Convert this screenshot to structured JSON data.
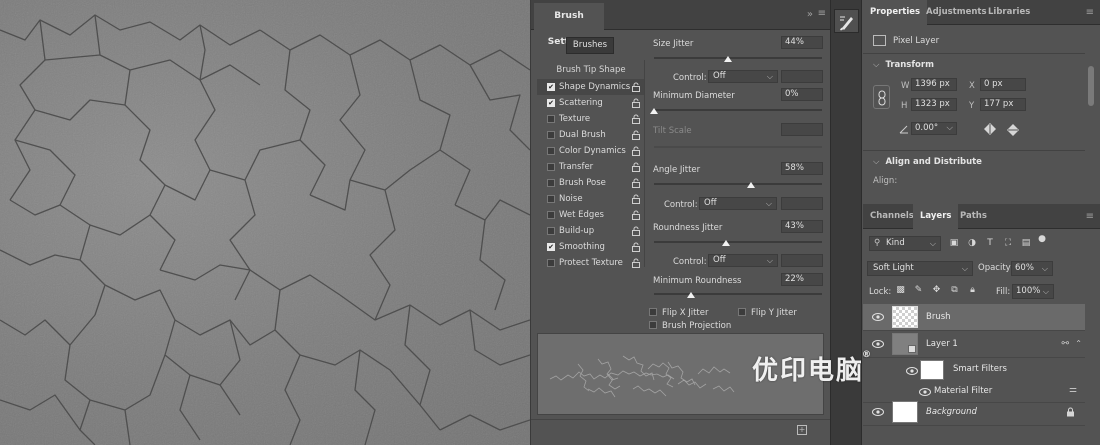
{
  "brush_settings": {
    "tab_label": "Brush Settings",
    "brushes_button": "Brushes",
    "options_header": "Brush Tip Shape",
    "options": [
      {
        "label": "Shape Dynamics",
        "checked": true,
        "selected": true
      },
      {
        "label": "Scattering",
        "checked": true,
        "selected": false
      },
      {
        "label": "Texture",
        "checked": false,
        "selected": false
      },
      {
        "label": "Dual Brush",
        "checked": false,
        "selected": false
      },
      {
        "label": "Color Dynamics",
        "checked": false,
        "selected": false
      },
      {
        "label": "Transfer",
        "checked": false,
        "selected": false
      },
      {
        "label": "Brush Pose",
        "checked": false,
        "selected": false
      },
      {
        "label": "Noise",
        "checked": false,
        "selected": false
      },
      {
        "label": "Wet Edges",
        "checked": false,
        "selected": false
      },
      {
        "label": "Build-up",
        "checked": false,
        "selected": false
      },
      {
        "label": "Smoothing",
        "checked": true,
        "selected": false
      },
      {
        "label": "Protect Texture",
        "checked": false,
        "selected": false
      }
    ],
    "size_jitter": {
      "label": "Size Jitter",
      "value": "44%",
      "slider": 0.44
    },
    "size_control": {
      "label": "Control:",
      "value": "Off"
    },
    "min_diameter": {
      "label": "Minimum Diameter",
      "value": "0%",
      "slider": 0.0
    },
    "tilt_scale": {
      "label": "Tilt Scale",
      "value": ""
    },
    "angle_jitter": {
      "label": "Angle Jitter",
      "value": "58%",
      "slider": 0.58
    },
    "angle_control": {
      "label": "Control:",
      "value": "Off"
    },
    "roundness_jitter": {
      "label": "Roundness Jitter",
      "value": "43%",
      "slider": 0.43
    },
    "roundness_control": {
      "label": "Control:",
      "value": "Off"
    },
    "min_roundness": {
      "label": "Minimum Roundness",
      "value": "22%",
      "slider": 0.22
    },
    "flip_x": "Flip X Jitter",
    "flip_y": "Flip Y Jitter",
    "brush_projection": "Brush Projection"
  },
  "properties": {
    "tabs": [
      "Properties",
      "Adjustments",
      "Libraries"
    ],
    "layer_type": "Pixel Layer",
    "transform_title": "Transform",
    "w_label": "W",
    "w_value": "1396 px",
    "x_label": "X",
    "x_value": "0 px",
    "h_label": "H",
    "h_value": "1323 px",
    "y_label": "Y",
    "y_value": "177 px",
    "angle_value": "0.00°",
    "align_title": "Align and Distribute",
    "align_label": "Align:"
  },
  "layers_panel": {
    "tabs": [
      "Channels",
      "Layers",
      "Paths"
    ],
    "kind": "Kind",
    "blend_mode": "Soft Light",
    "opacity_label": "Opacity:",
    "opacity_value": "60%",
    "lock_label": "Lock:",
    "fill_label": "Fill:",
    "fill_value": "100%",
    "layers": [
      {
        "name": "Brush"
      },
      {
        "name": "Layer 1"
      },
      {
        "name": "Smart Filters"
      },
      {
        "name": "Material Filter"
      },
      {
        "name": "Background"
      }
    ]
  },
  "watermark": "优印电脑",
  "colors": {
    "panel": "#535353",
    "dark": "#424242",
    "field": "#474747",
    "selected_layer": "#6a6a6a"
  }
}
